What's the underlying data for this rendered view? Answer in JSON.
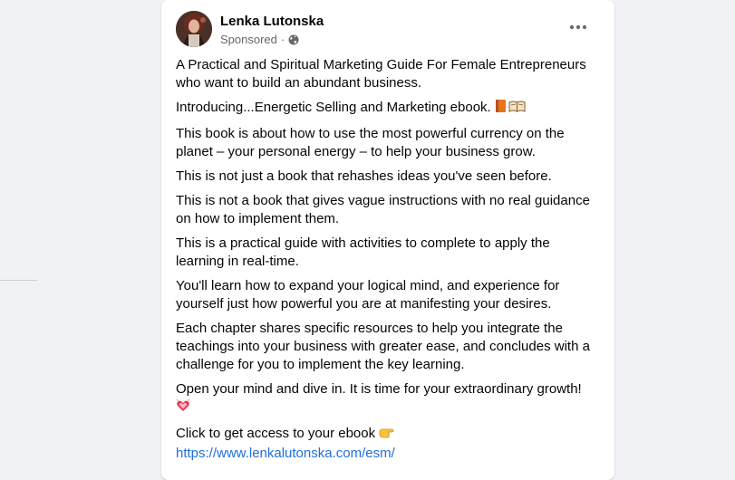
{
  "post": {
    "author": "Lenka Lutonska",
    "sponsored_label": "Sponsored",
    "meta_separator": "·",
    "icons": {
      "privacy": "globe-icon",
      "more": "more-options-icon",
      "book_emojis": "books-emoji",
      "heart_emoji": "sparkling-heart-emoji",
      "hand_emoji": "pointing-right-hand-emoji"
    },
    "paragraphs": {
      "p1": "A Practical and Spiritual Marketing Guide For Female Entrepreneurs who want to build an abundant business.",
      "p2": "Introducing...Energetic Selling and Marketing ebook.",
      "p3": "This book is about how to use the most powerful currency on the planet – your personal energy – to help your business grow.",
      "p4": "This is not just a book that rehashes ideas you've seen before.",
      "p5": "This is not a book that gives vague instructions with no real guidance on how to implement them.",
      "p6": "This is a practical guide with activities to complete to apply the learning in real-time.",
      "p7": "You'll learn how to expand your logical mind, and experience for yourself just how powerful you are at manifesting your desires.",
      "p8": "Each chapter shares specific resources to help you integrate the teachings into your business with greater ease, and concludes with a challenge for you to implement the key learning.",
      "p9": "Open your mind and dive in. It is time for your extraordinary growth!",
      "p10": "Click to get access to your ebook"
    },
    "link": "https://www.lenkalutonska.com/esm/"
  },
  "colors": {
    "link": "#216fdb",
    "text": "#050505",
    "secondary": "#65676b",
    "background": "#f0f2f5"
  }
}
